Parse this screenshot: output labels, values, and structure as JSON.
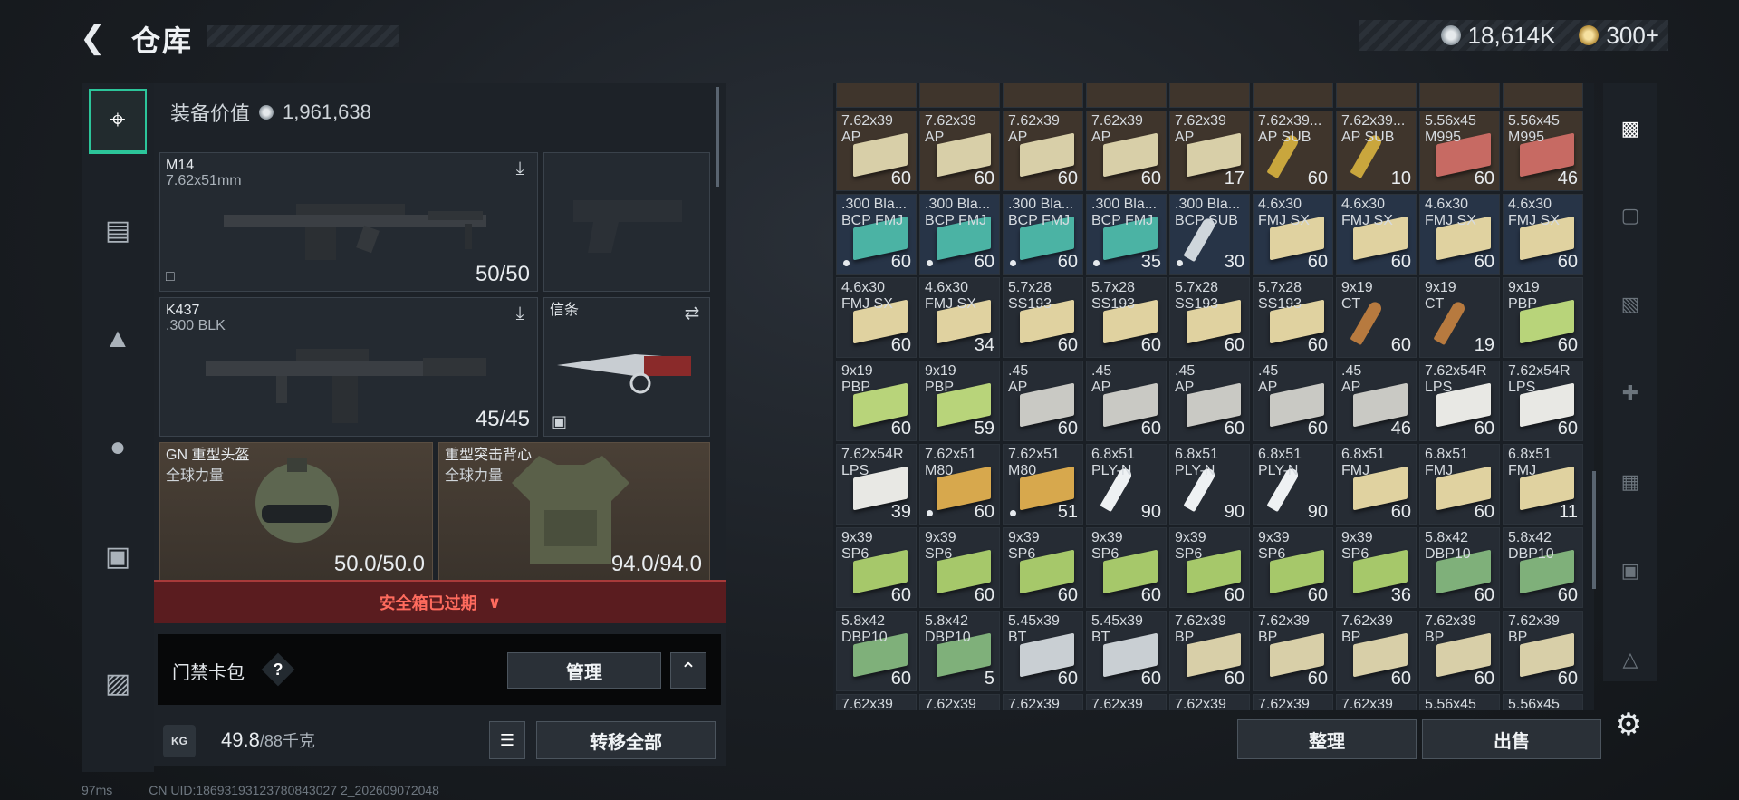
{
  "header": {
    "title": "仓库",
    "back_icon": "back-arrow-icon"
  },
  "currency": {
    "silver": "18,614K",
    "gold": "300+"
  },
  "left_sidebar": {
    "tabs": [
      "pistol-icon",
      "vest-icon",
      "backpack-icon",
      "bag-icon",
      "container-icon",
      "briefcase-icon"
    ]
  },
  "equipment": {
    "value_label": "装备价值",
    "value": "1,961,638",
    "primary": {
      "name": "M14",
      "caliber": "7.62x51mm",
      "ammo": "50/50"
    },
    "secondary": {
      "name": "K437",
      "caliber": ".300 BLK",
      "ammo": "45/45"
    },
    "melee": {
      "label": "信条"
    },
    "helmet": {
      "name": "GN 重型头盔",
      "brand": "全球力量",
      "durability": "50.0/50.0"
    },
    "armor": {
      "name": "重型突击背心",
      "brand": "全球力量",
      "durability": "94.0/94.0"
    }
  },
  "safebox": {
    "expired_text": "安全箱已过期"
  },
  "card_pack": {
    "label": "门禁卡包",
    "help": "?",
    "manage": "管理"
  },
  "weight": {
    "current": "49.8",
    "max": "/88千克",
    "icon_text": "KG"
  },
  "transfer_all": "转移全部",
  "status_bar": {
    "ping": "97ms",
    "uid": "CN UID:18693193123780843027 2_202609072048"
  },
  "inventory": {
    "columns": 9,
    "top_partial": [
      "",
      "",
      "",
      "",
      "",
      "",
      "",
      "",
      ""
    ],
    "rows": [
      [
        {
          "l1": "7.62x39",
          "l2": "AP",
          "q": "60",
          "c": "brown",
          "k": "box",
          "col": "#d8cfa8"
        },
        {
          "l1": "7.62x39",
          "l2": "AP",
          "q": "60",
          "c": "brown",
          "k": "box",
          "col": "#d8cfa8"
        },
        {
          "l1": "7.62x39",
          "l2": "AP",
          "q": "60",
          "c": "brown",
          "k": "box",
          "col": "#d8cfa8"
        },
        {
          "l1": "7.62x39",
          "l2": "AP",
          "q": "60",
          "c": "brown",
          "k": "box",
          "col": "#d8cfa8"
        },
        {
          "l1": "7.62x39",
          "l2": "AP",
          "q": "17",
          "c": "brown",
          "k": "box",
          "col": "#d8cfa8"
        },
        {
          "l1": "7.62x39...",
          "l2": "AP SUB",
          "q": "60",
          "c": "brown",
          "k": "bullet",
          "col": "#c9a63d"
        },
        {
          "l1": "7.62x39...",
          "l2": "AP SUB",
          "q": "10",
          "c": "brown",
          "k": "bullet",
          "col": "#c9a63d"
        },
        {
          "l1": "5.56x45",
          "l2": "M995",
          "q": "60",
          "c": "brown",
          "k": "box",
          "col": "#c76a63"
        },
        {
          "l1": "5.56x45",
          "l2": "M995",
          "q": "46",
          "c": "brown",
          "k": "box",
          "col": "#c76a63"
        }
      ],
      [
        {
          "l1": ".300 Bla...",
          "l2": "BCP FMJ",
          "q": "60",
          "c": "blue",
          "k": "box",
          "col": "#4bb3a4",
          "dot": true
        },
        {
          "l1": ".300 Bla...",
          "l2": "BCP FMJ",
          "q": "60",
          "c": "blue",
          "k": "box",
          "col": "#4bb3a4",
          "dot": true
        },
        {
          "l1": ".300 Bla...",
          "l2": "BCP FMJ",
          "q": "60",
          "c": "blue",
          "k": "box",
          "col": "#4bb3a4",
          "dot": true
        },
        {
          "l1": ".300 Bla...",
          "l2": "BCP FMJ",
          "q": "35",
          "c": "blue",
          "k": "box",
          "col": "#4bb3a4",
          "dot": true
        },
        {
          "l1": ".300 Bla...",
          "l2": "BCP SUB",
          "q": "30",
          "c": "blue",
          "k": "bullet",
          "col": "#cfd6dc",
          "dot": true
        },
        {
          "l1": "4.6x30",
          "l2": "FMJ SX",
          "q": "60",
          "c": "blue",
          "k": "box",
          "col": "#e0d2a0"
        },
        {
          "l1": "4.6x30",
          "l2": "FMJ SX",
          "q": "60",
          "c": "blue",
          "k": "box",
          "col": "#e0d2a0"
        },
        {
          "l1": "4.6x30",
          "l2": "FMJ SX",
          "q": "60",
          "c": "blue",
          "k": "box",
          "col": "#e0d2a0"
        },
        {
          "l1": "4.6x30",
          "l2": "FMJ SX",
          "q": "60",
          "c": "blue",
          "k": "box",
          "col": "#e0d2a0"
        }
      ],
      [
        {
          "l1": "4.6x30",
          "l2": "FMJ SX",
          "q": "60",
          "c": "gray",
          "k": "box",
          "col": "#e0d2a0"
        },
        {
          "l1": "4.6x30",
          "l2": "FMJ SX",
          "q": "34",
          "c": "gray",
          "k": "box",
          "col": "#e0d2a0"
        },
        {
          "l1": "5.7x28",
          "l2": "SS193",
          "q": "60",
          "c": "gray",
          "k": "box",
          "col": "#e0d2a0"
        },
        {
          "l1": "5.7x28",
          "l2": "SS193",
          "q": "60",
          "c": "gray",
          "k": "box",
          "col": "#e0d2a0"
        },
        {
          "l1": "5.7x28",
          "l2": "SS193",
          "q": "60",
          "c": "gray",
          "k": "box",
          "col": "#e0d2a0"
        },
        {
          "l1": "5.7x28",
          "l2": "SS193",
          "q": "60",
          "c": "gray",
          "k": "box",
          "col": "#e0d2a0"
        },
        {
          "l1": "9x19",
          "l2": "CT",
          "q": "60",
          "c": "gray",
          "k": "bullet",
          "col": "#b77a3f"
        },
        {
          "l1": "9x19",
          "l2": "CT",
          "q": "19",
          "c": "gray",
          "k": "bullet",
          "col": "#b77a3f"
        },
        {
          "l1": "9x19",
          "l2": "PBP",
          "q": "60",
          "c": "gray",
          "k": "box",
          "col": "#b8d47a"
        }
      ],
      [
        {
          "l1": "9x19",
          "l2": "PBP",
          "q": "60",
          "c": "gray",
          "k": "box",
          "col": "#b8d47a"
        },
        {
          "l1": "9x19",
          "l2": "PBP",
          "q": "59",
          "c": "gray",
          "k": "box",
          "col": "#b8d47a"
        },
        {
          "l1": ".45",
          "l2": "AP",
          "q": "60",
          "c": "gray",
          "k": "box",
          "col": "#c9c9c4"
        },
        {
          "l1": ".45",
          "l2": "AP",
          "q": "60",
          "c": "gray",
          "k": "box",
          "col": "#c9c9c4"
        },
        {
          "l1": ".45",
          "l2": "AP",
          "q": "60",
          "c": "gray",
          "k": "box",
          "col": "#c9c9c4"
        },
        {
          "l1": ".45",
          "l2": "AP",
          "q": "60",
          "c": "gray",
          "k": "box",
          "col": "#c9c9c4"
        },
        {
          "l1": ".45",
          "l2": "AP",
          "q": "46",
          "c": "gray",
          "k": "box",
          "col": "#c9c9c4"
        },
        {
          "l1": "7.62x54R",
          "l2": "LPS",
          "q": "60",
          "c": "gray",
          "k": "box",
          "col": "#e8e8e4"
        },
        {
          "l1": "7.62x54R",
          "l2": "LPS",
          "q": "60",
          "c": "gray",
          "k": "box",
          "col": "#e8e8e4"
        }
      ],
      [
        {
          "l1": "7.62x54R",
          "l2": "LPS",
          "q": "39",
          "c": "gray",
          "k": "box",
          "col": "#e8e8e4"
        },
        {
          "l1": "7.62x51",
          "l2": "M80",
          "q": "60",
          "c": "gray",
          "k": "box",
          "col": "#d7a84d",
          "dot": true
        },
        {
          "l1": "7.62x51",
          "l2": "M80",
          "q": "51",
          "c": "gray",
          "k": "box",
          "col": "#d7a84d",
          "dot": true
        },
        {
          "l1": "6.8x51",
          "l2": "PLY-N",
          "q": "90",
          "c": "gray",
          "k": "bullet",
          "col": "#eef1f3"
        },
        {
          "l1": "6.8x51",
          "l2": "PLY-N",
          "q": "90",
          "c": "gray",
          "k": "bullet",
          "col": "#eef1f3"
        },
        {
          "l1": "6.8x51",
          "l2": "PLY-N",
          "q": "90",
          "c": "gray",
          "k": "bullet",
          "col": "#eef1f3"
        },
        {
          "l1": "6.8x51",
          "l2": "FMJ",
          "q": "60",
          "c": "gray",
          "k": "box",
          "col": "#e0d2a0"
        },
        {
          "l1": "6.8x51",
          "l2": "FMJ",
          "q": "60",
          "c": "gray",
          "k": "box",
          "col": "#e0d2a0"
        },
        {
          "l1": "6.8x51",
          "l2": "FMJ",
          "q": "11",
          "c": "gray",
          "k": "box",
          "col": "#e0d2a0"
        }
      ],
      [
        {
          "l1": "9x39",
          "l2": "SP6",
          "q": "60",
          "c": "gray",
          "k": "box",
          "col": "#a6c86a"
        },
        {
          "l1": "9x39",
          "l2": "SP6",
          "q": "60",
          "c": "gray",
          "k": "box",
          "col": "#a6c86a"
        },
        {
          "l1": "9x39",
          "l2": "SP6",
          "q": "60",
          "c": "gray",
          "k": "box",
          "col": "#a6c86a"
        },
        {
          "l1": "9x39",
          "l2": "SP6",
          "q": "60",
          "c": "gray",
          "k": "box",
          "col": "#a6c86a"
        },
        {
          "l1": "9x39",
          "l2": "SP6",
          "q": "60",
          "c": "gray",
          "k": "box",
          "col": "#a6c86a"
        },
        {
          "l1": "9x39",
          "l2": "SP6",
          "q": "60",
          "c": "gray",
          "k": "box",
          "col": "#a6c86a"
        },
        {
          "l1": "9x39",
          "l2": "SP6",
          "q": "36",
          "c": "gray",
          "k": "box",
          "col": "#a6c86a"
        },
        {
          "l1": "5.8x42",
          "l2": "DBP10",
          "q": "60",
          "c": "gray",
          "k": "box",
          "col": "#7fb07a"
        },
        {
          "l1": "5.8x42",
          "l2": "DBP10",
          "q": "60",
          "c": "gray",
          "k": "box",
          "col": "#7fb07a"
        }
      ],
      [
        {
          "l1": "5.8x42",
          "l2": "DBP10",
          "q": "60",
          "c": "gray",
          "k": "box",
          "col": "#7fb07a"
        },
        {
          "l1": "5.8x42",
          "l2": "DBP10",
          "q": "5",
          "c": "gray",
          "k": "box",
          "col": "#7fb07a"
        },
        {
          "l1": "5.45x39",
          "l2": "BT",
          "q": "60",
          "c": "gray",
          "k": "box",
          "col": "#c9cfd3"
        },
        {
          "l1": "5.45x39",
          "l2": "BT",
          "q": "60",
          "c": "gray",
          "k": "box",
          "col": "#c9cfd3"
        },
        {
          "l1": "7.62x39",
          "l2": "BP",
          "q": "60",
          "c": "gray",
          "k": "box",
          "col": "#d8cfa8"
        },
        {
          "l1": "7.62x39",
          "l2": "BP",
          "q": "60",
          "c": "gray",
          "k": "box",
          "col": "#d8cfa8"
        },
        {
          "l1": "7.62x39",
          "l2": "BP",
          "q": "60",
          "c": "gray",
          "k": "box",
          "col": "#d8cfa8"
        },
        {
          "l1": "7.62x39",
          "l2": "BP",
          "q": "60",
          "c": "gray",
          "k": "box",
          "col": "#d8cfa8"
        },
        {
          "l1": "7.62x39",
          "l2": "BP",
          "q": "60",
          "c": "gray",
          "k": "box",
          "col": "#d8cfa8"
        }
      ],
      [
        {
          "l1": "7.62x39",
          "l2": "",
          "q": "",
          "c": "gray",
          "k": "none"
        },
        {
          "l1": "7.62x39",
          "l2": "",
          "q": "",
          "c": "gray",
          "k": "none"
        },
        {
          "l1": "7.62x39",
          "l2": "",
          "q": "",
          "c": "gray",
          "k": "none"
        },
        {
          "l1": "7.62x39",
          "l2": "",
          "q": "",
          "c": "gray",
          "k": "none"
        },
        {
          "l1": "7.62x39",
          "l2": "",
          "q": "",
          "c": "gray",
          "k": "none"
        },
        {
          "l1": "7.62x39",
          "l2": "",
          "q": "",
          "c": "gray",
          "k": "none"
        },
        {
          "l1": "7.62x39",
          "l2": "",
          "q": "",
          "c": "gray",
          "k": "none"
        },
        {
          "l1": "5.56x45",
          "l2": "",
          "q": "",
          "c": "gray",
          "k": "none"
        },
        {
          "l1": "5.56x45",
          "l2": "",
          "q": "",
          "c": "gray",
          "k": "none"
        }
      ]
    ]
  },
  "right_sidebar": {
    "tabs": [
      "safe-icon",
      "level4-rig-icon",
      "level4-bag-icon",
      "level4-medkit-icon",
      "level5-vest-icon",
      "level5-container-icon",
      "level4-helmet-icon"
    ]
  },
  "buttons": {
    "sort": "整理",
    "sell": "出售"
  },
  "colors": {
    "accent": "#2cc59a",
    "alert": "#ff6b5e"
  }
}
